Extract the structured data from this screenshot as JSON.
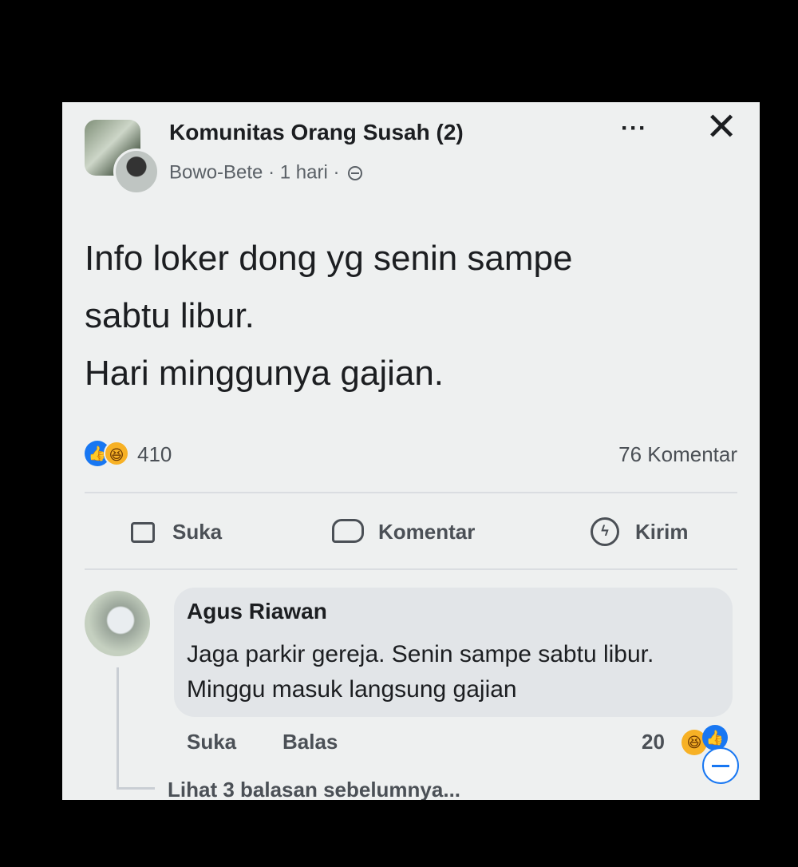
{
  "post": {
    "group_name": "Komunitas Orang Susah (2)",
    "author": "Bowo-Bete",
    "time": "1 hari",
    "separator": "·",
    "more_label": "···",
    "close_label": "✕",
    "text": "Info loker dong yg senin sampe\nsabtu libur.\nHari minggunya gajian.",
    "reaction_count": "410",
    "comment_count": "76 Komentar"
  },
  "actions": {
    "like_label": "Suka",
    "comment_label": "Komentar",
    "send_label": "Kirim"
  },
  "comment": {
    "author": "Agus Riawan",
    "text": "Jaga parkir gereja. Senin sampe sabtu libur. Minggu masuk langsung gajian",
    "like_label": "Suka",
    "reply_label": "Balas",
    "reaction_count": "20",
    "view_previous": "Lihat 3 balasan sebelumnya..."
  },
  "colors": {
    "background": "#000000",
    "card": "#eef0f0",
    "like_blue": "#1877f2",
    "haha_yellow": "#f7b125"
  }
}
